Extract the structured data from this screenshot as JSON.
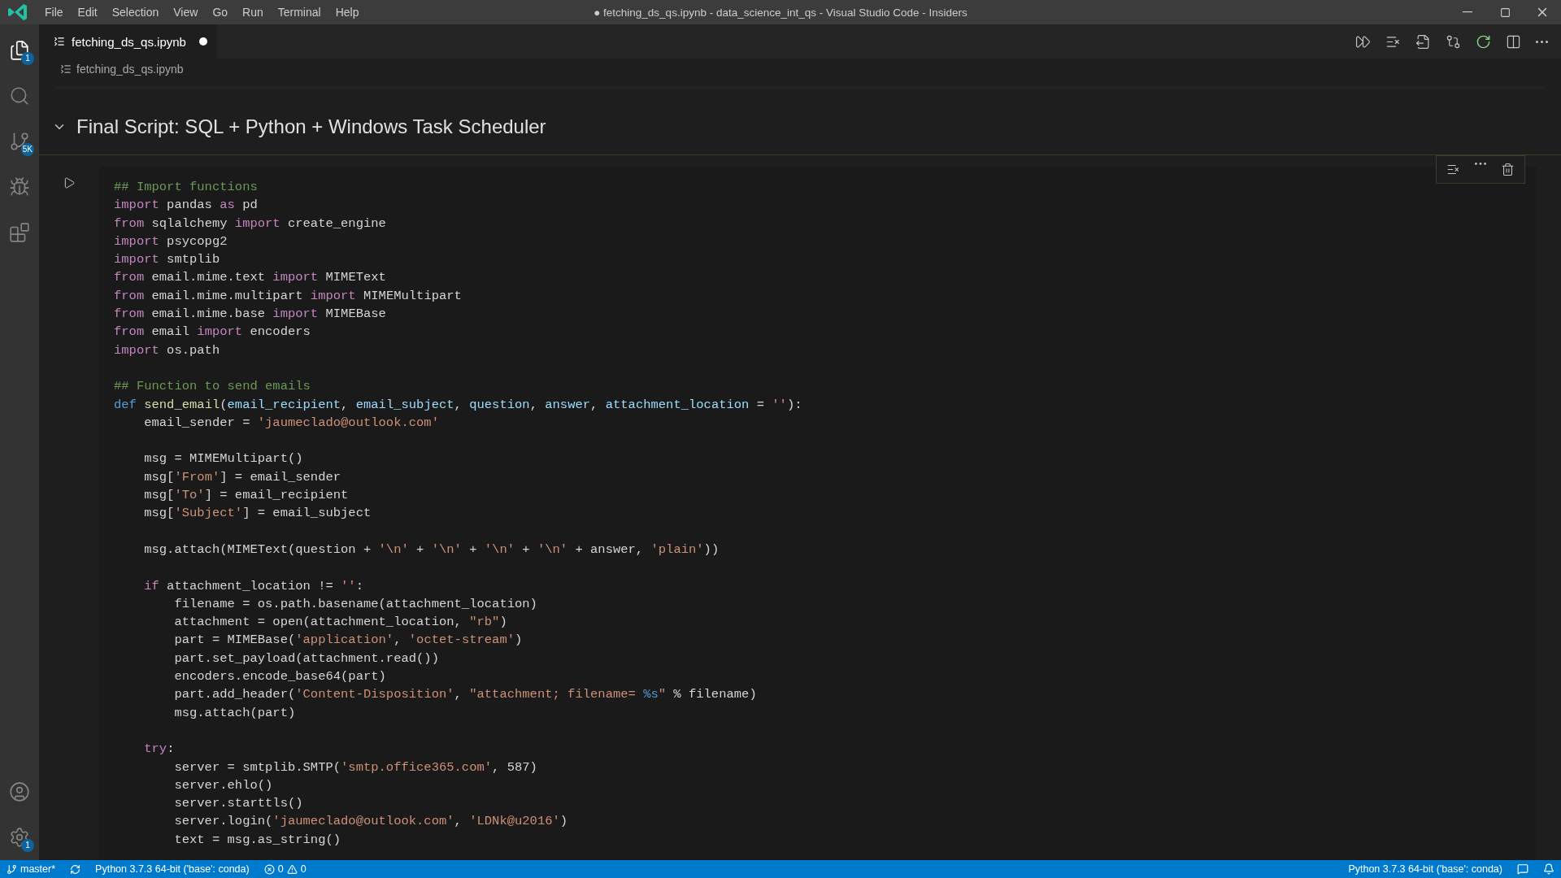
{
  "title_bar": {
    "menu": [
      "File",
      "Edit",
      "Selection",
      "View",
      "Go",
      "Run",
      "Terminal",
      "Help"
    ],
    "title": "● fetching_ds_qs.ipynb - data_science_int_qs - Visual Studio Code - Insiders"
  },
  "activity_bar": {
    "top": [
      {
        "kind": "files",
        "badge": "1"
      },
      {
        "kind": "search"
      },
      {
        "kind": "source-control",
        "badge": "5K"
      },
      {
        "kind": "run-debug"
      },
      {
        "kind": "extensions"
      }
    ],
    "bottom": [
      {
        "kind": "account"
      },
      {
        "kind": "settings",
        "badge": "1"
      }
    ]
  },
  "tabs": [
    {
      "label": "fetching_ds_qs.ipynb",
      "selected": true,
      "dirty": true
    }
  ],
  "breadcrumb": "fetching_ds_qs.ipynb",
  "markdown_cell": {
    "heading": "Final Script: SQL + Python + Windows Task Scheduler",
    "expanded": true
  },
  "code_cell": {
    "lines": [
      {
        "gap_before": false,
        "tokens": [
          {
            "kind": "com",
            "t": "## Import functions"
          }
        ]
      },
      {
        "gap_before": false,
        "tokens": [
          {
            "kind": "kw",
            "t": "import"
          },
          {
            "kind": "txt",
            "t": " pandas "
          },
          {
            "kind": "kw",
            "t": "as"
          },
          {
            "kind": "txt",
            "t": " pd"
          }
        ]
      },
      {
        "gap_before": false,
        "tokens": [
          {
            "kind": "kw",
            "t": "from"
          },
          {
            "kind": "txt",
            "t": " sqlalchemy "
          },
          {
            "kind": "kw",
            "t": "import"
          },
          {
            "kind": "txt",
            "t": " create_engine"
          }
        ]
      },
      {
        "gap_before": false,
        "tokens": [
          {
            "kind": "kw",
            "t": "import"
          },
          {
            "kind": "txt",
            "t": " psycopg2"
          }
        ]
      },
      {
        "gap_before": false,
        "tokens": [
          {
            "kind": "kw",
            "t": "import"
          },
          {
            "kind": "txt",
            "t": " smtplib"
          }
        ]
      },
      {
        "gap_before": false,
        "tokens": [
          {
            "kind": "kw",
            "t": "from"
          },
          {
            "kind": "txt",
            "t": " email.mime.text "
          },
          {
            "kind": "kw",
            "t": "import"
          },
          {
            "kind": "txt",
            "t": " MIMEText"
          }
        ]
      },
      {
        "gap_before": false,
        "tokens": [
          {
            "kind": "kw",
            "t": "from"
          },
          {
            "kind": "txt",
            "t": " email.mime.multipart "
          },
          {
            "kind": "kw",
            "t": "import"
          },
          {
            "kind": "txt",
            "t": " MIMEMultipart"
          }
        ]
      },
      {
        "gap_before": false,
        "tokens": [
          {
            "kind": "kw",
            "t": "from"
          },
          {
            "kind": "txt",
            "t": " email.mime.base "
          },
          {
            "kind": "kw",
            "t": "import"
          },
          {
            "kind": "txt",
            "t": " MIMEBase"
          }
        ]
      },
      {
        "gap_before": false,
        "tokens": [
          {
            "kind": "kw",
            "t": "from"
          },
          {
            "kind": "txt",
            "t": " email "
          },
          {
            "kind": "kw",
            "t": "import"
          },
          {
            "kind": "txt",
            "t": " encoders"
          }
        ]
      },
      {
        "gap_before": false,
        "tokens": [
          {
            "kind": "kw",
            "t": "import"
          },
          {
            "kind": "txt",
            "t": " os.path"
          }
        ]
      },
      {
        "gap_before": true,
        "tokens": [
          {
            "kind": "com",
            "t": "## Function to send emails"
          }
        ]
      },
      {
        "gap_before": false,
        "tokens": [
          {
            "kind": "def",
            "t": "def "
          },
          {
            "kind": "fn",
            "t": "send_email"
          },
          {
            "kind": "txt",
            "t": "("
          },
          {
            "kind": "param",
            "t": "email_recipient"
          },
          {
            "kind": "txt",
            "t": ", "
          },
          {
            "kind": "param",
            "t": "email_subject"
          },
          {
            "kind": "txt",
            "t": ", "
          },
          {
            "kind": "param",
            "t": "question"
          },
          {
            "kind": "txt",
            "t": ", "
          },
          {
            "kind": "param",
            "t": "answer"
          },
          {
            "kind": "txt",
            "t": ", "
          },
          {
            "kind": "param",
            "t": "attachment_location"
          },
          {
            "kind": "txt",
            "t": " = "
          },
          {
            "kind": "str",
            "t": "''"
          },
          {
            "kind": "txt",
            "t": "):"
          }
        ]
      },
      {
        "gap_before": false,
        "tokens": [
          {
            "kind": "txt",
            "t": "    email_sender = "
          },
          {
            "kind": "str",
            "t": "'jaumeclado@outlook.com'"
          }
        ]
      },
      {
        "gap_before": true,
        "tokens": [
          {
            "kind": "txt",
            "t": "    msg = MIMEMultipart()"
          }
        ]
      },
      {
        "gap_before": false,
        "tokens": [
          {
            "kind": "txt",
            "t": "    msg["
          },
          {
            "kind": "str",
            "t": "'From'"
          },
          {
            "kind": "txt",
            "t": "] = email_sender"
          }
        ]
      },
      {
        "gap_before": false,
        "tokens": [
          {
            "kind": "txt",
            "t": "    msg["
          },
          {
            "kind": "str",
            "t": "'To'"
          },
          {
            "kind": "txt",
            "t": "] = email_recipient"
          }
        ]
      },
      {
        "gap_before": false,
        "tokens": [
          {
            "kind": "txt",
            "t": "    msg["
          },
          {
            "kind": "str",
            "t": "'Subject'"
          },
          {
            "kind": "txt",
            "t": "] = email_subject"
          }
        ]
      },
      {
        "gap_before": true,
        "tokens": [
          {
            "kind": "txt",
            "t": "    msg.attach(MIMEText(question + "
          },
          {
            "kind": "str",
            "t": "'\\n'"
          },
          {
            "kind": "txt",
            "t": " + "
          },
          {
            "kind": "str",
            "t": "'\\n'"
          },
          {
            "kind": "txt",
            "t": " + "
          },
          {
            "kind": "str",
            "t": "'\\n'"
          },
          {
            "kind": "txt",
            "t": " + "
          },
          {
            "kind": "str",
            "t": "'\\n'"
          },
          {
            "kind": "txt",
            "t": " + answer, "
          },
          {
            "kind": "str",
            "t": "'plain'"
          },
          {
            "kind": "txt",
            "t": "))"
          }
        ]
      },
      {
        "gap_before": true,
        "tokens": [
          {
            "kind": "kw",
            "t": "    if"
          },
          {
            "kind": "txt",
            "t": " attachment_location != "
          },
          {
            "kind": "str",
            "t": "''"
          },
          {
            "kind": "txt",
            "t": ":"
          }
        ]
      },
      {
        "gap_before": false,
        "tokens": [
          {
            "kind": "txt",
            "t": "        filename = os.path.basename(attachment_location)"
          }
        ]
      },
      {
        "gap_before": false,
        "tokens": [
          {
            "kind": "txt",
            "t": "        attachment = open(attachment_location, "
          },
          {
            "kind": "str",
            "t": "\"rb\""
          },
          {
            "kind": "txt",
            "t": ")"
          }
        ]
      },
      {
        "gap_before": false,
        "tokens": [
          {
            "kind": "txt",
            "t": "        part = MIMEBase("
          },
          {
            "kind": "str",
            "t": "'application'"
          },
          {
            "kind": "txt",
            "t": ", "
          },
          {
            "kind": "str",
            "t": "'octet-stream'"
          },
          {
            "kind": "txt",
            "t": ")"
          }
        ]
      },
      {
        "gap_before": false,
        "tokens": [
          {
            "kind": "txt",
            "t": "        part.set_payload(attachment.read())"
          }
        ]
      },
      {
        "gap_before": false,
        "tokens": [
          {
            "kind": "txt",
            "t": "        encoders.encode_base64(part)"
          }
        ]
      },
      {
        "gap_before": false,
        "tokens": [
          {
            "kind": "txt",
            "t": "        part.add_header("
          },
          {
            "kind": "str",
            "t": "'Content-Disposition'"
          },
          {
            "kind": "txt",
            "t": ", "
          },
          {
            "kind": "str",
            "t": "\"attachment; filename= "
          },
          {
            "kind": "def",
            "t": "%s"
          },
          {
            "kind": "str",
            "t": "\""
          },
          {
            "kind": "txt",
            "t": " % filename)"
          }
        ]
      },
      {
        "gap_before": false,
        "tokens": [
          {
            "kind": "txt",
            "t": "        msg.attach(part)"
          }
        ]
      },
      {
        "gap_before": true,
        "tokens": [
          {
            "kind": "kw",
            "t": "    try"
          },
          {
            "kind": "txt",
            "t": ":"
          }
        ]
      },
      {
        "gap_before": false,
        "tokens": [
          {
            "kind": "txt",
            "t": "        server = smtplib.SMTP("
          },
          {
            "kind": "str",
            "t": "'smtp.office365.com'"
          },
          {
            "kind": "txt",
            "t": ", 587)"
          }
        ]
      },
      {
        "gap_before": false,
        "tokens": [
          {
            "kind": "txt",
            "t": "        server.ehlo()"
          }
        ]
      },
      {
        "gap_before": false,
        "tokens": [
          {
            "kind": "txt",
            "t": "        server.starttls()"
          }
        ]
      },
      {
        "gap_before": false,
        "tokens": [
          {
            "kind": "txt",
            "t": "        server.login("
          },
          {
            "kind": "str",
            "t": "'jaumeclado@outlook.com'"
          },
          {
            "kind": "txt",
            "t": ", "
          },
          {
            "kind": "str",
            "t": "'LDNk@u2016'"
          },
          {
            "kind": "txt",
            "t": ")"
          }
        ]
      },
      {
        "gap_before": false,
        "tokens": [
          {
            "kind": "txt",
            "t": "        text = msg.as_string()"
          }
        ]
      }
    ]
  },
  "status_bar": {
    "branch": "master*",
    "interpreter": "Python 3.7.3 64-bit ('base': conda)",
    "errors": "0",
    "warnings": "0",
    "right_interpreter": "Python 3.7.3 64-bit ('base': conda)"
  }
}
